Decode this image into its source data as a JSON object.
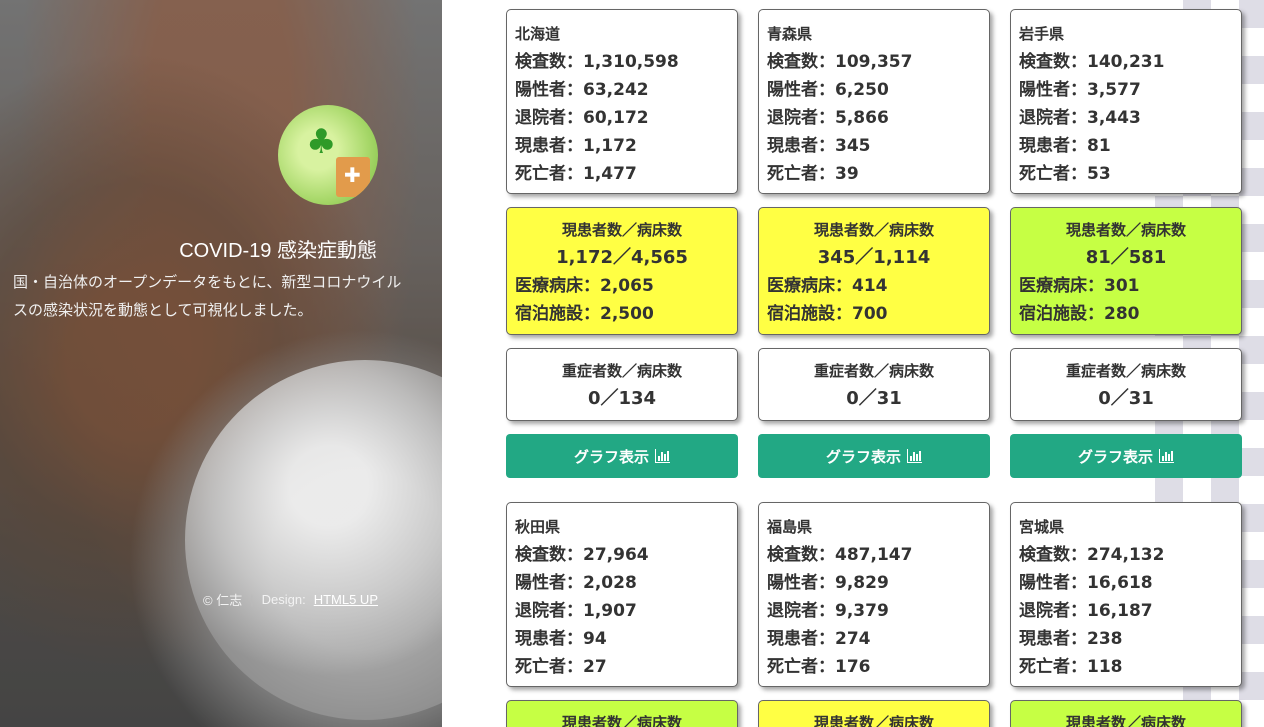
{
  "sidebar": {
    "title": "COVID-19 感染症動態",
    "description": "国・自治体のオープンデータをもとに、新型コロナウイルスの感染状況を動態として可視化しました。",
    "footer_copyright": "© 仁志",
    "footer_design_label": "Design:",
    "footer_design_link": "HTML5 UP"
  },
  "prefectures": [
    {
      "name": "北海道",
      "tests": "検査数：1,310,598",
      "positives": "陽性者：63,242",
      "discharged": "退院者：60,172",
      "current": "現患者：1,172",
      "deaths": "死亡者：1,477",
      "beds_header": "現患者数／病床数",
      "beds_ratio": "1,172／4,565",
      "hospital_beds": "医療病床：2,065",
      "lodging": "宿泊施設：2,500",
      "beds_status": "yellow",
      "severe_header": "重症者数／病床数",
      "severe_ratio": "0／134",
      "graph_button": "グラフ表示"
    },
    {
      "name": "青森県",
      "tests": "検査数：109,357",
      "positives": "陽性者：6,250",
      "discharged": "退院者：5,866",
      "current": "現患者：345",
      "deaths": "死亡者：39",
      "beds_header": "現患者数／病床数",
      "beds_ratio": "345／1,114",
      "hospital_beds": "医療病床：414",
      "lodging": "宿泊施設：700",
      "beds_status": "yellow",
      "severe_header": "重症者数／病床数",
      "severe_ratio": "0／31",
      "graph_button": "グラフ表示"
    },
    {
      "name": "岩手県",
      "tests": "検査数：140,231",
      "positives": "陽性者：3,577",
      "discharged": "退院者：3,443",
      "current": "現患者：81",
      "deaths": "死亡者：53",
      "beds_header": "現患者数／病床数",
      "beds_ratio": "81／581",
      "hospital_beds": "医療病床：301",
      "lodging": "宿泊施設：280",
      "beds_status": "green",
      "severe_header": "重症者数／病床数",
      "severe_ratio": "0／31",
      "graph_button": "グラフ表示"
    },
    {
      "name": "秋田県",
      "tests": "検査数：27,964",
      "positives": "陽性者：2,028",
      "discharged": "退院者：1,907",
      "current": "現患者：94",
      "deaths": "死亡者：27",
      "beds_header": "現患者数／病床数",
      "beds_status": "green"
    },
    {
      "name": "福島県",
      "tests": "検査数：487,147",
      "positives": "陽性者：9,829",
      "discharged": "退院者：9,379",
      "current": "現患者：274",
      "deaths": "死亡者：176",
      "beds_header": "現患者数／病床数",
      "beds_status": "yellow"
    },
    {
      "name": "宮城県",
      "tests": "検査数：274,132",
      "positives": "陽性者：16,618",
      "discharged": "退院者：16,187",
      "current": "現患者：238",
      "deaths": "死亡者：118",
      "beds_header": "現患者数／病床数",
      "beds_status": "green"
    }
  ],
  "colors": {
    "yellow_card": "#ffff44",
    "green_card": "#c6ff44",
    "button": "#22a884"
  },
  "icons": {
    "graph": "bar-chart-icon"
  }
}
